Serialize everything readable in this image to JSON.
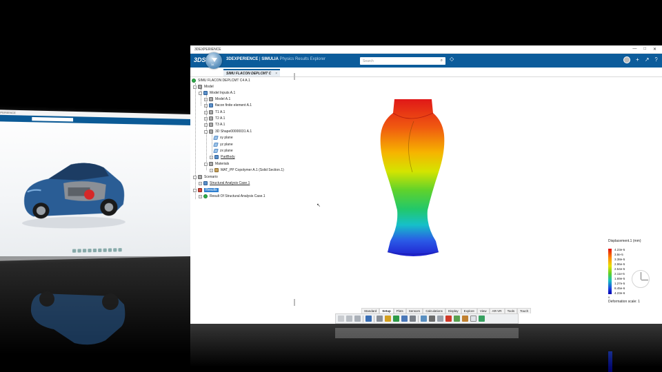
{
  "main_window": {
    "titlebar_text": "3DEXPERIENCE",
    "window_controls": [
      "—",
      "□",
      "✕"
    ],
    "brand": {
      "logo_glyph": "3DS",
      "title_bold": "3DEXPERIENCE",
      "title_separator": " | ",
      "title_app": "SIMULIA",
      "title_sub": " Physics Results Explorer",
      "compass_badge": "3A"
    },
    "search_placeholder": "Search",
    "tab": {
      "label": "SIMU FLACON DEPLCMT C",
      "close": "×"
    }
  },
  "tree": {
    "root": "SIMU FLACON DEPLCMT C4 A.1",
    "model": "Model",
    "model_inputs": "Model Inputs A.1",
    "model_a1": "Model A.1",
    "flacon_element": "flacon finite element A.1",
    "t1": "T1 A.1",
    "t2": "T2 A.1",
    "t3": "T3 A.1",
    "shape": "3D Shape00000031 A.1",
    "xy_plane": "xy plane",
    "yz_plane": "yz plane",
    "zx_plane": "zx plane",
    "part_body": "PartBody",
    "materials": "Materials",
    "material_item": "MAT_PP Copolymer A.1 (Solid Section.1)",
    "scenario": "Scenario",
    "structural_case": "Structural Analysis Case.1",
    "results": "Results",
    "result_item": "Result Of Structural Analysis Case.1"
  },
  "legend": {
    "title": "Displacement.1 (mm)",
    "values": [
      "4.23e-5",
      "3.8e-5",
      "3.38e-5",
      "2.96e-5",
      "2.54e-5",
      "2.11e-5",
      "1.69e-5",
      "1.27e-5",
      "8.45e-6",
      "4.23e-6"
    ],
    "zero": "0",
    "deformation_scale": "Deformation scale: 1"
  },
  "toolbar": {
    "tabs": [
      "Standard",
      "Setup",
      "Plots",
      "Sensors",
      "Calculations",
      "Display",
      "Explore",
      "View",
      "AR-VR",
      "Tools",
      "Touch"
    ],
    "active_tab": "Setup"
  },
  "colors": {
    "accent": "#0c5c9b",
    "contour_max": "#e01010",
    "contour_min": "#0000b0"
  },
  "left_window": {
    "title": "3DEXPERIENCE"
  }
}
